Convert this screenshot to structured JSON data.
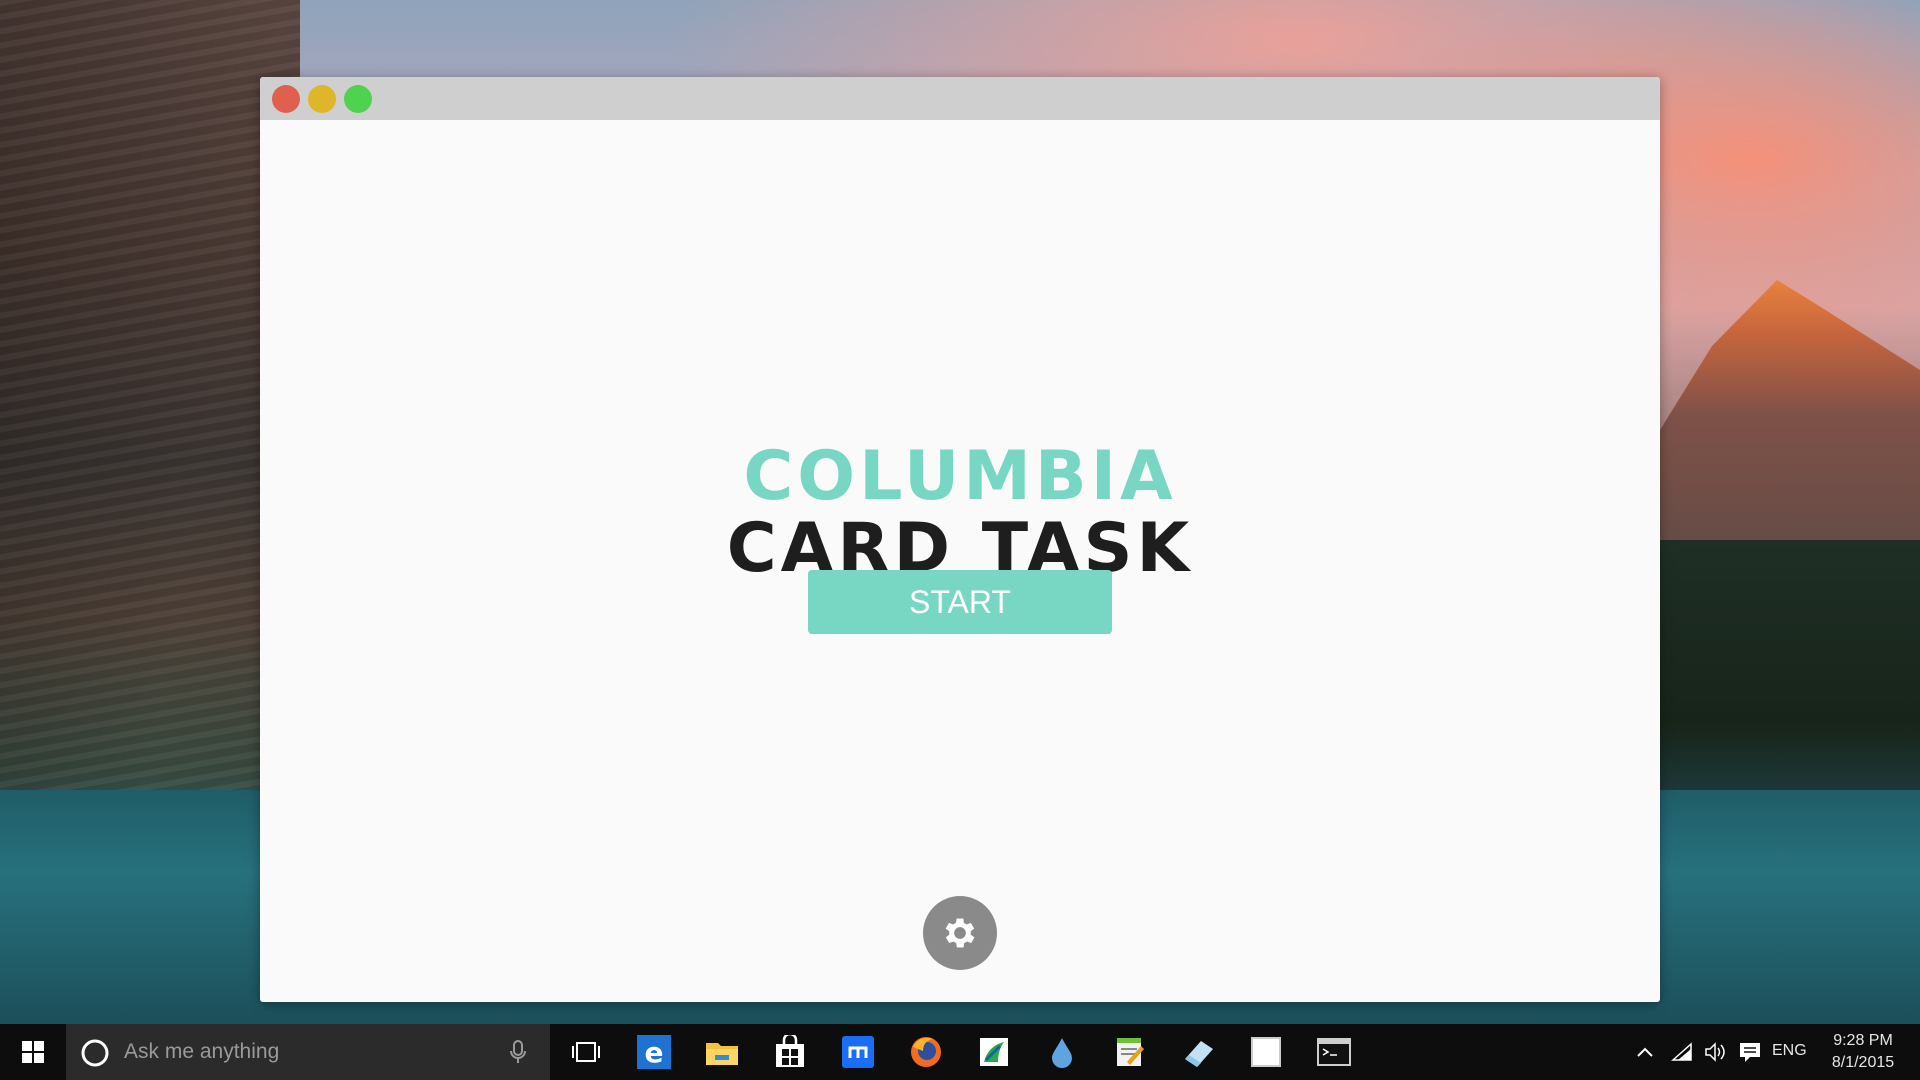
{
  "app": {
    "title_line1": "COLUMBIA",
    "title_line2": "CARD TASK",
    "start_label": "START"
  },
  "taskbar": {
    "search_placeholder": "Ask me anything",
    "apps": [
      {
        "icon": "task-view-icon"
      },
      {
        "icon": "edge-icon"
      },
      {
        "icon": "file-explorer-icon"
      },
      {
        "icon": "store-icon"
      },
      {
        "icon": "teamviewer-icon"
      },
      {
        "icon": "firefox-icon"
      },
      {
        "icon": "inkscape-icon"
      },
      {
        "icon": "drop-icon"
      },
      {
        "icon": "notepad-icon"
      },
      {
        "icon": "eraser-icon"
      },
      {
        "icon": "blank-window-icon"
      },
      {
        "icon": "terminal-icon"
      }
    ],
    "tray": {
      "language": "ENG",
      "time": "9:28 PM",
      "date": "8/1/2015"
    }
  },
  "colors": {
    "accent": "#78d7c3",
    "title_dark": "#1e1e1e",
    "close": "#e0604f",
    "minimize": "#dfb52a",
    "maximize": "#4fd34f",
    "settings": "#8a8a8a"
  }
}
